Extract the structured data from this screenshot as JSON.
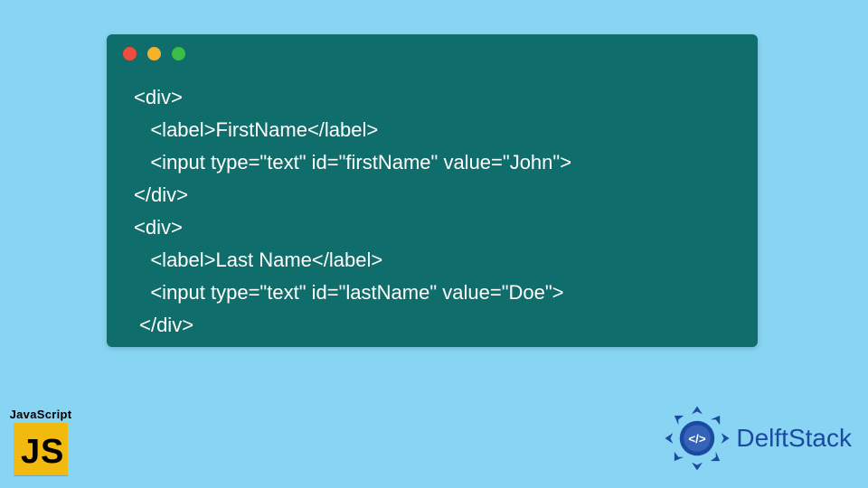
{
  "window": {
    "dots": [
      "red",
      "yellow",
      "green"
    ]
  },
  "code": {
    "lines": [
      "<div>",
      "   <label>FirstName</label>",
      "   <input type=\"text\" id=\"firstName\" value=\"John\">",
      "</div>",
      "<div>",
      "   <label>Last Name</label>",
      "   <input type=\"text\" id=\"lastName\" value=\"Doe\">",
      " </div>"
    ]
  },
  "js_badge": {
    "label": "JavaScript",
    "glyph_j": "J",
    "glyph_s": "S"
  },
  "delftstack": {
    "name": "DelftStack",
    "tag_glyph": "</>"
  },
  "colors": {
    "page_bg": "#87d4f3",
    "window_bg": "#0f6d6b",
    "code_fg": "#ffffff",
    "js_tile": "#f2b90f",
    "delft_blue": "#1b4aa0"
  }
}
